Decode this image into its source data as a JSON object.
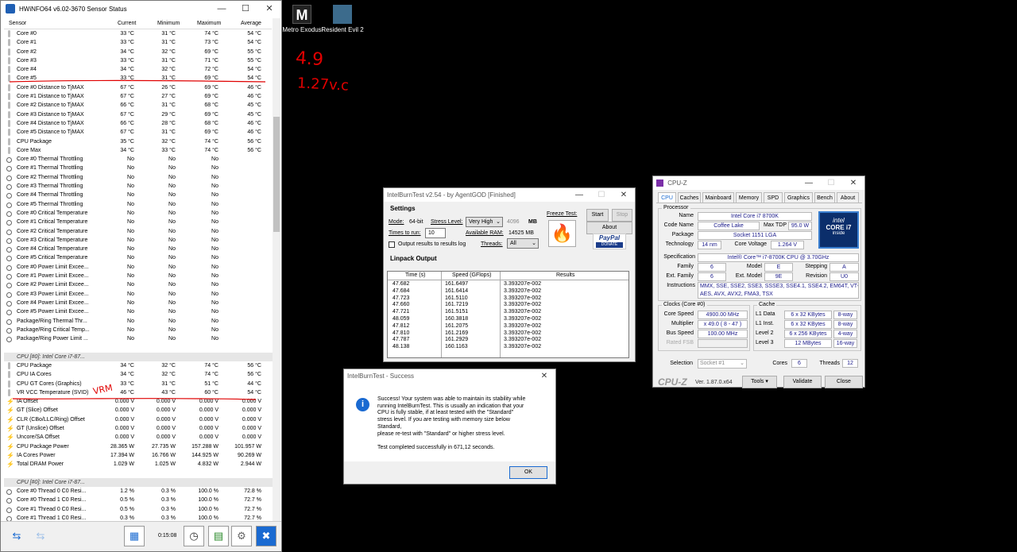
{
  "hwinfo": {
    "title": "HWiNFO64 v6.02-3670 Sensor Status",
    "cols": [
      "Sensor",
      "Current",
      "Minimum",
      "Maximum",
      "Average"
    ],
    "rows": [
      {
        "t": "th",
        "n": "Core #0",
        "c": "33 °C",
        "mi": "31 °C",
        "ma": "74 °C",
        "av": "54 °C"
      },
      {
        "t": "th",
        "n": "Core #1",
        "c": "33 °C",
        "mi": "31 °C",
        "ma": "73 °C",
        "av": "54 °C"
      },
      {
        "t": "th",
        "n": "Core #2",
        "c": "34 °C",
        "mi": "32 °C",
        "ma": "69 °C",
        "av": "55 °C"
      },
      {
        "t": "th",
        "n": "Core #3",
        "c": "33 °C",
        "mi": "31 °C",
        "ma": "71 °C",
        "av": "55 °C"
      },
      {
        "t": "th",
        "n": "Core #4",
        "c": "34 °C",
        "mi": "32 °C",
        "ma": "72 °C",
        "av": "54 °C"
      },
      {
        "t": "th",
        "n": "Core #5",
        "c": "33 °C",
        "mi": "31 °C",
        "ma": "69 °C",
        "av": "54 °C"
      },
      {
        "t": "th",
        "n": "Core #0 Distance to TjMAX",
        "c": "67 °C",
        "mi": "26 °C",
        "ma": "69 °C",
        "av": "46 °C"
      },
      {
        "t": "th",
        "n": "Core #1 Distance to TjMAX",
        "c": "67 °C",
        "mi": "27 °C",
        "ma": "69 °C",
        "av": "46 °C"
      },
      {
        "t": "th",
        "n": "Core #2 Distance to TjMAX",
        "c": "66 °C",
        "mi": "31 °C",
        "ma": "68 °C",
        "av": "45 °C"
      },
      {
        "t": "th",
        "n": "Core #3 Distance to TjMAX",
        "c": "67 °C",
        "mi": "29 °C",
        "ma": "69 °C",
        "av": "45 °C"
      },
      {
        "t": "th",
        "n": "Core #4 Distance to TjMAX",
        "c": "66 °C",
        "mi": "28 °C",
        "ma": "68 °C",
        "av": "46 °C"
      },
      {
        "t": "th",
        "n": "Core #5 Distance to TjMAX",
        "c": "67 °C",
        "mi": "31 °C",
        "ma": "69 °C",
        "av": "46 °C"
      },
      {
        "t": "th",
        "n": "CPU Package",
        "c": "35 °C",
        "mi": "32 °C",
        "ma": "74 °C",
        "av": "56 °C"
      },
      {
        "t": "th",
        "n": "Core Max",
        "c": "34 °C",
        "mi": "33 °C",
        "ma": "74 °C",
        "av": "56 °C"
      },
      {
        "t": "ri",
        "n": "Core #0 Thermal Throttling",
        "c": "No",
        "mi": "No",
        "ma": "No",
        "av": ""
      },
      {
        "t": "ri",
        "n": "Core #1 Thermal Throttling",
        "c": "No",
        "mi": "No",
        "ma": "No",
        "av": ""
      },
      {
        "t": "ri",
        "n": "Core #2 Thermal Throttling",
        "c": "No",
        "mi": "No",
        "ma": "No",
        "av": ""
      },
      {
        "t": "ri",
        "n": "Core #3 Thermal Throttling",
        "c": "No",
        "mi": "No",
        "ma": "No",
        "av": ""
      },
      {
        "t": "ri",
        "n": "Core #4 Thermal Throttling",
        "c": "No",
        "mi": "No",
        "ma": "No",
        "av": ""
      },
      {
        "t": "ri",
        "n": "Core #5 Thermal Throttling",
        "c": "No",
        "mi": "No",
        "ma": "No",
        "av": ""
      },
      {
        "t": "ri",
        "n": "Core #0 Critical Temperature",
        "c": "No",
        "mi": "No",
        "ma": "No",
        "av": ""
      },
      {
        "t": "ri",
        "n": "Core #1 Critical Temperature",
        "c": "No",
        "mi": "No",
        "ma": "No",
        "av": ""
      },
      {
        "t": "ri",
        "n": "Core #2 Critical Temperature",
        "c": "No",
        "mi": "No",
        "ma": "No",
        "av": ""
      },
      {
        "t": "ri",
        "n": "Core #3 Critical Temperature",
        "c": "No",
        "mi": "No",
        "ma": "No",
        "av": ""
      },
      {
        "t": "ri",
        "n": "Core #4 Critical Temperature",
        "c": "No",
        "mi": "No",
        "ma": "No",
        "av": ""
      },
      {
        "t": "ri",
        "n": "Core #5 Critical Temperature",
        "c": "No",
        "mi": "No",
        "ma": "No",
        "av": ""
      },
      {
        "t": "ri",
        "n": "Core #0 Power Limit Excee...",
        "c": "No",
        "mi": "No",
        "ma": "No",
        "av": ""
      },
      {
        "t": "ri",
        "n": "Core #1 Power Limit Excee...",
        "c": "No",
        "mi": "No",
        "ma": "No",
        "av": ""
      },
      {
        "t": "ri",
        "n": "Core #2 Power Limit Excee...",
        "c": "No",
        "mi": "No",
        "ma": "No",
        "av": ""
      },
      {
        "t": "ri",
        "n": "Core #3 Power Limit Excee...",
        "c": "No",
        "mi": "No",
        "ma": "No",
        "av": ""
      },
      {
        "t": "ri",
        "n": "Core #4 Power Limit Excee...",
        "c": "No",
        "mi": "No",
        "ma": "No",
        "av": ""
      },
      {
        "t": "ri",
        "n": "Core #5 Power Limit Excee...",
        "c": "No",
        "mi": "No",
        "ma": "No",
        "av": ""
      },
      {
        "t": "ri",
        "n": "Package/Ring Thermal Thr...",
        "c": "No",
        "mi": "No",
        "ma": "No",
        "av": ""
      },
      {
        "t": "ri",
        "n": "Package/Ring Critical Temp...",
        "c": "No",
        "mi": "No",
        "ma": "No",
        "av": ""
      },
      {
        "t": "ri",
        "n": "Package/Ring Power Limit ...",
        "c": "No",
        "mi": "No",
        "ma": "No",
        "av": ""
      },
      {
        "t": "gap"
      },
      {
        "t": "grp",
        "n": "CPU [#0]: Intel Core i7-87..."
      },
      {
        "t": "th",
        "n": "CPU Package",
        "c": "34 °C",
        "mi": "32 °C",
        "ma": "74 °C",
        "av": "56 °C"
      },
      {
        "t": "th",
        "n": "CPU IA Cores",
        "c": "34 °C",
        "mi": "32 °C",
        "ma": "74 °C",
        "av": "56 °C"
      },
      {
        "t": "th",
        "n": "CPU GT Cores (Graphics)",
        "c": "33 °C",
        "mi": "31 °C",
        "ma": "51 °C",
        "av": "44 °C"
      },
      {
        "t": "th",
        "n": "VR VCC Temperature (SVID)",
        "c": "46 °C",
        "mi": "43 °C",
        "ma": "60 °C",
        "av": "54 °C"
      },
      {
        "t": "bolt",
        "n": "IA Offset",
        "c": "0.000 V",
        "mi": "0.000 V",
        "ma": "0.000 V",
        "av": "0.000 V"
      },
      {
        "t": "bolt",
        "n": "GT (Slice) Offset",
        "c": "0.000 V",
        "mi": "0.000 V",
        "ma": "0.000 V",
        "av": "0.000 V"
      },
      {
        "t": "bolt",
        "n": "CLR (CBo/LLC/Ring) Offset",
        "c": "0.000 V",
        "mi": "0.000 V",
        "ma": "0.000 V",
        "av": "0.000 V"
      },
      {
        "t": "bolt",
        "n": "GT (Unslice) Offset",
        "c": "0.000 V",
        "mi": "0.000 V",
        "ma": "0.000 V",
        "av": "0.000 V"
      },
      {
        "t": "bolt",
        "n": "Uncore/SA Offset",
        "c": "0.000 V",
        "mi": "0.000 V",
        "ma": "0.000 V",
        "av": "0.000 V"
      },
      {
        "t": "bolt",
        "n": "CPU Package Power",
        "c": "28.365 W",
        "mi": "27.735 W",
        "ma": "157.288 W",
        "av": "101.957 W"
      },
      {
        "t": "bolt",
        "n": "IA Cores Power",
        "c": "17.394 W",
        "mi": "16.766 W",
        "ma": "144.925 W",
        "av": "90.269 W"
      },
      {
        "t": "bolt",
        "n": "Total DRAM Power",
        "c": "1.029 W",
        "mi": "1.025 W",
        "ma": "4.832 W",
        "av": "2.944 W"
      },
      {
        "t": "gap"
      },
      {
        "t": "grp",
        "n": "CPU [#0]: Intel Core i7-87..."
      },
      {
        "t": "ri",
        "n": "Core #0 Thread 0 C0 Resi...",
        "c": "1.2 %",
        "mi": "0.3 %",
        "ma": "100.0 %",
        "av": "72.8 %"
      },
      {
        "t": "ri",
        "n": "Core #0 Thread 1 C0 Resi...",
        "c": "0.5 %",
        "mi": "0.3 %",
        "ma": "100.0 %",
        "av": "72.7 %"
      },
      {
        "t": "ri",
        "n": "Core #1 Thread 0 C0 Resi...",
        "c": "0.5 %",
        "mi": "0.3 %",
        "ma": "100.0 %",
        "av": "72.7 %"
      },
      {
        "t": "ri",
        "n": "Core #1 Thread 1 C0 Resi...",
        "c": "0.3 %",
        "mi": "0.3 %",
        "ma": "100.0 %",
        "av": "72.7 %"
      }
    ],
    "footer": {
      "time": "0:15:08"
    }
  },
  "desktop": {
    "icons": [
      "Metro Exodus",
      "Resident Evil 2"
    ]
  },
  "annotations": {
    "freq": "4.9",
    "volt": "1.27v.c",
    "vrm": "VRM",
    "color": "#e00000"
  },
  "ibt": {
    "title": "IntelBurnTest v2.54 - by AgentGOD [Finished]",
    "settings": "Settings",
    "mode_l": "Mode:",
    "mode_v": "64-bit",
    "stress_l": "Stress Level:",
    "stress_v": "Very High",
    "stress_n": "4096",
    "mb": "MB",
    "times_l": "Times to run:",
    "times_v": "10",
    "ram_l": "Available RAM:",
    "ram_v": "14525 MB",
    "output_l": "Output results to results log",
    "threads_l": "Threads:",
    "threads_v": "All",
    "freeze_l": "Freeze Test:",
    "start": "Start",
    "stop": "Stop",
    "about": "About",
    "paypal": "PayPal",
    "donate": "DONATE",
    "lp_title": "Linpack Output",
    "lp_cols": [
      "Time (s)",
      "Speed (GFlops)",
      "Results"
    ],
    "lp_rows": [
      [
        "47.682",
        "161.6497",
        "3.393207e-002"
      ],
      [
        "47.684",
        "161.6414",
        "3.393207e-002"
      ],
      [
        "47.723",
        "161.5110",
        "3.393207e-002"
      ],
      [
        "47.660",
        "161.7219",
        "3.393207e-002"
      ],
      [
        "47.721",
        "161.5151",
        "3.393207e-002"
      ],
      [
        "48.059",
        "160.3818",
        "3.393207e-002"
      ],
      [
        "47.812",
        "161.2075",
        "3.393207e-002"
      ],
      [
        "47.810",
        "161.2169",
        "3.393207e-002"
      ],
      [
        "47.787",
        "161.2929",
        "3.393207e-002"
      ],
      [
        "48.138",
        "160.1163",
        "3.393207e-002"
      ]
    ]
  },
  "success": {
    "title": "IntelBurnTest - Success",
    "l1": "Success! Your system was able to maintain its stability while",
    "l2": "running IntelBurnTest. This is usually an indication that your",
    "l3": "CPU is fully stable, if at least tested with the \"Standard\"",
    "l4": "stress level. If you are testing with memory size below",
    "l5": "Standard,",
    "l6": "please re-test with \"Standard\" or higher stress level.",
    "l7": "Test completed successfully in 671,12 seconds.",
    "ok": "OK"
  },
  "cpuz": {
    "title": "CPU-Z",
    "tabs": [
      "CPU",
      "Caches",
      "Mainboard",
      "Memory",
      "SPD",
      "Graphics",
      "Bench",
      "About"
    ],
    "processor": "Processor",
    "name_k": "Name",
    "name": "Intel Core i7 8700K",
    "code_k": "Code Name",
    "code": "Coffee Lake",
    "tdp_k": "Max TDP",
    "tdp": "95.0 W",
    "pkg_k": "Package",
    "pkg": "Socket 1151 LGA",
    "tech_k": "Technology",
    "tech": "14 nm",
    "cv_k": "Core Voltage",
    "cv": "1.264 V",
    "spec_k": "Specification",
    "spec": "Intel® Core™ i7-8700K CPU @ 3.70GHz",
    "fam_k": "Family",
    "fam": "6",
    "mod_k": "Model",
    "mod": "E",
    "step_k": "Stepping",
    "step": "A",
    "efam_k": "Ext. Family",
    "efam": "6",
    "emod_k": "Ext. Model",
    "emod": "9E",
    "rev_k": "Revision",
    "rev": "U0",
    "instr_k": "Instructions",
    "instr1": "MMX, SSE, SSE2, SSE3, SSSE3, SSE4.1, SSE4.2, EM64T, VT-x,",
    "instr2": "AES, AVX, AVX2, FMA3, TSX",
    "clocks": "Clocks (Core #0)",
    "cs_k": "Core Speed",
    "cs": "4900.00 MHz",
    "mul_k": "Multiplier",
    "mul": "x 49.0 ( 8 - 47 )",
    "bus_k": "Bus Speed",
    "bus": "100.00 MHz",
    "fsb_k": "Rated FSB",
    "cache": "Cache",
    "l1d_k": "L1 Data",
    "l1d": "6 x 32 KBytes",
    "l1d_w": "8-way",
    "l1i_k": "L1 Inst.",
    "l1i": "6 x 32 KBytes",
    "l1i_w": "8-way",
    "l2_k": "Level 2",
    "l2": "6 x 256 KBytes",
    "l2_w": "4-way",
    "l3_k": "Level 3",
    "l3": "12 MBytes",
    "l3_w": "16-way",
    "sel_k": "Selection",
    "sel": "Socket #1",
    "cores_k": "Cores",
    "cores": "6",
    "threads_k": "Threads",
    "threads": "12",
    "brand": "CPU-Z",
    "ver": "Ver. 1.87.0.x64",
    "tools": "Tools",
    "validate": "Validate",
    "close": "Close",
    "logo1": "intel",
    "logo2": "CORE i7",
    "logo3": "inside"
  }
}
